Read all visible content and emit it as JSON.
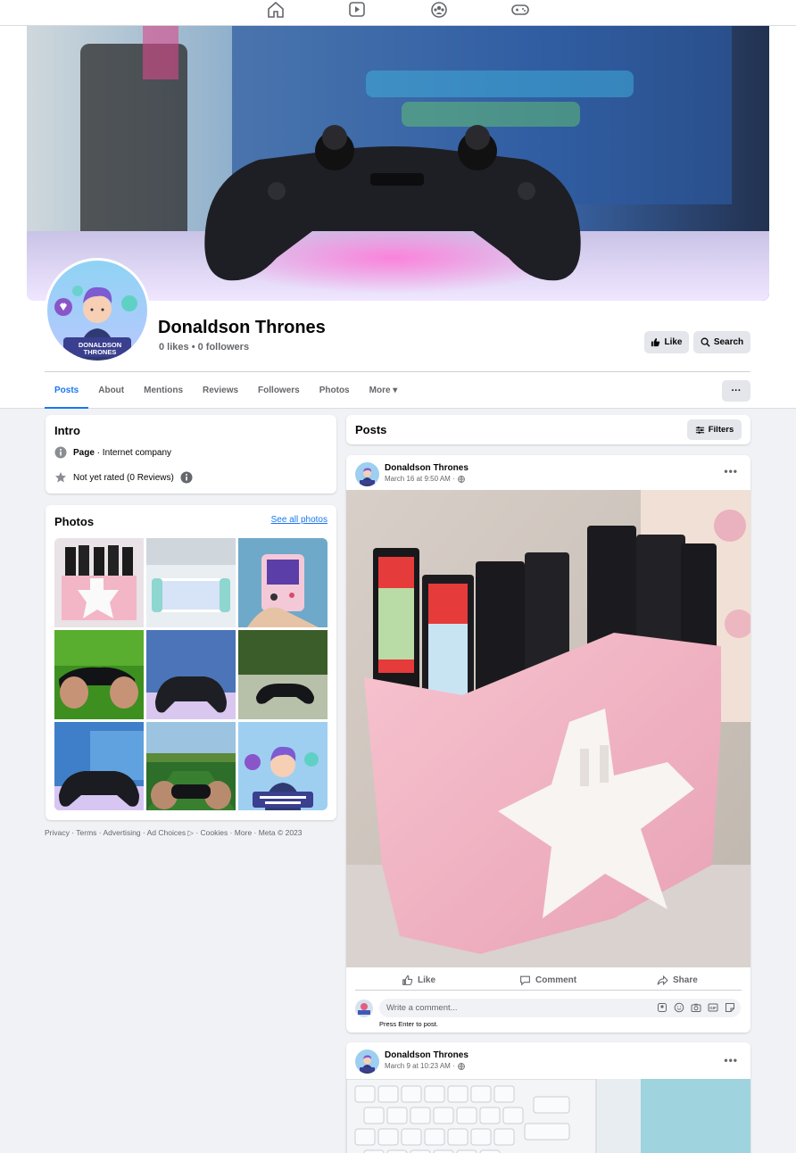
{
  "page": {
    "name": "Donaldson Thrones",
    "stats": "0 likes • 0 followers",
    "like_button": "Like",
    "search_button": "Search",
    "more_button": "···"
  },
  "topnav": {
    "icons": [
      "home-icon",
      "video-icon",
      "groups-icon",
      "gaming-icon"
    ]
  },
  "tabs": [
    {
      "label": "Posts",
      "active": true
    },
    {
      "label": "About"
    },
    {
      "label": "Mentions"
    },
    {
      "label": "Reviews"
    },
    {
      "label": "Followers"
    },
    {
      "label": "Photos"
    },
    {
      "label": "More ▾"
    }
  ],
  "intro": {
    "title": "Intro",
    "category_bold": "Page",
    "category_rest": " · Internet company",
    "rating": "Not yet rated (0 Reviews)"
  },
  "photos": {
    "title": "Photos",
    "see_all": "See all photos"
  },
  "footer": "Privacy · Terms · Advertising · Ad Choices ▷ · Cookies · More · Meta © 2023",
  "posts_header": {
    "title": "Posts",
    "filters": "Filters"
  },
  "posts": [
    {
      "author": "Donaldson Thrones",
      "meta": "March 16 at 9:50 AM ·",
      "actions": {
        "like": "Like",
        "comment": "Comment",
        "share": "Share"
      },
      "comment_placeholder": "Write a comment...",
      "press_enter": "Press Enter to post."
    },
    {
      "author": "Donaldson Thrones",
      "meta": "March 9 at 10:23 AM ·"
    }
  ],
  "avatar_text": "DONALDSON THRONES",
  "colors": {
    "accent": "#1877f2",
    "background": "#f0f2f5",
    "secondary_text": "#65676b",
    "button_gray": "#e4e6eb"
  }
}
